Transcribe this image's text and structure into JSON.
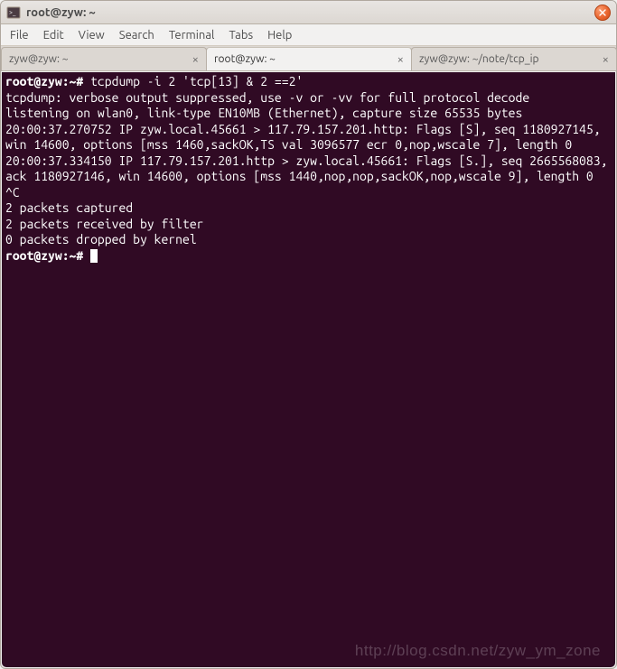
{
  "window": {
    "title": "root@zyw: ~"
  },
  "menu": {
    "file": "File",
    "edit": "Edit",
    "view": "View",
    "search": "Search",
    "terminal": "Terminal",
    "tabs": "Tabs",
    "help": "Help"
  },
  "tabs": [
    {
      "label": "zyw@zyw: ~"
    },
    {
      "label": "root@zyw: ~"
    },
    {
      "label": "zyw@zyw: ~/note/tcp_ip"
    }
  ],
  "term": {
    "prompt1": "root@zyw:~#",
    "cmd1": " tcpdump -i 2 'tcp[13] & 2 ==2'",
    "out": "tcpdump: verbose output suppressed, use -v or -vv for full protocol decode\nlistening on wlan0, link-type EN10MB (Ethernet), capture size 65535 bytes\n20:00:37.270752 IP zyw.local.45661 > 117.79.157.201.http: Flags [S], seq 1180927145, win 14600, options [mss 1460,sackOK,TS val 3096577 ecr 0,nop,wscale 7], length 0\n20:00:37.334150 IP 117.79.157.201.http > zyw.local.45661: Flags [S.], seq 2665568083, ack 1180927146, win 14600, options [mss 1440,nop,nop,sackOK,nop,wscale 9], length 0\n^C\n2 packets captured\n2 packets received by filter\n0 packets dropped by kernel",
    "prompt2": "root@zyw:~#",
    "trail": " "
  },
  "watermark": "http://blog.csdn.net/zyw_ym_zone"
}
